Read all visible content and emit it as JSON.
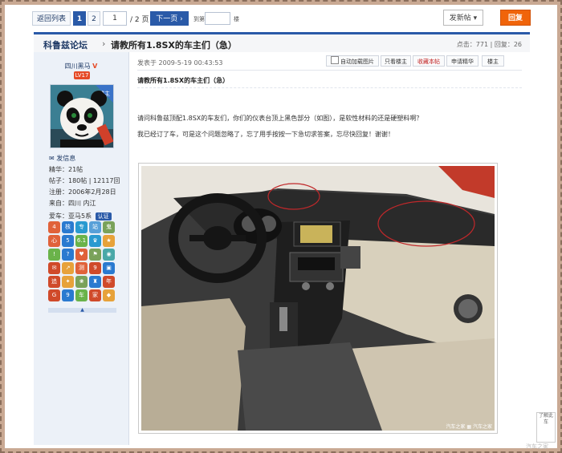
{
  "toolbar": {
    "back": "返回列表",
    "page1": "1",
    "page2": "2",
    "page_input": "1",
    "page_total": "/ 2 页",
    "next": "下一页 ›",
    "goto": "到第",
    "goto_unit": "楼",
    "new_post": "发新帖 ▾",
    "reply": "回复"
  },
  "titlebar": {
    "forum": "科鲁兹论坛",
    "separator": "›",
    "title": "请教所有1.8SX的车主们（急）",
    "stats": "点击：771 | 回复：26"
  },
  "author": {
    "name": "四川黑马",
    "v": "V",
    "level": "LV17",
    "badge": "楼主",
    "message": "发信息",
    "essence": "精华：21帖",
    "posts": "帖子：180帖 | 12117回",
    "registered": "注册：2006年2月28日",
    "from": "来自：四川 内江",
    "car": "爱车：亚马5系",
    "car_badge": "认证"
  },
  "medals": [
    {
      "t": "4",
      "c": "#e0623a"
    },
    {
      "t": "核",
      "c": "#2a7ad0"
    },
    {
      "t": "专",
      "c": "#2a9ad0"
    },
    {
      "t": "站",
      "c": "#58a0d8"
    },
    {
      "t": "鬼",
      "c": "#7aa25a"
    },
    {
      "t": "心",
      "c": "#e0623a"
    },
    {
      "t": "5",
      "c": "#2a7ad0"
    },
    {
      "t": "6.1",
      "c": "#6ab34a"
    },
    {
      "t": "♛",
      "c": "#2a9ad0"
    },
    {
      "t": "★",
      "c": "#e7a23a"
    },
    {
      "t": "!",
      "c": "#6ab34a"
    },
    {
      "t": "?",
      "c": "#2a7ad0"
    },
    {
      "t": "♥",
      "c": "#e0623a"
    },
    {
      "t": "⚑",
      "c": "#7aa25a"
    },
    {
      "t": "◉",
      "c": "#4aa8a8"
    },
    {
      "t": "✉",
      "c": "#d04a2a"
    },
    {
      "t": "↗",
      "c": "#e7a23a"
    },
    {
      "t": "测",
      "c": "#e0623a"
    },
    {
      "t": "9",
      "c": "#d04a2a"
    },
    {
      "t": "▣",
      "c": "#2a7ad0"
    },
    {
      "t": "追",
      "c": "#d04a2a"
    },
    {
      "t": "✦",
      "c": "#e7a23a"
    },
    {
      "t": "❀",
      "c": "#7aa25a"
    },
    {
      "t": "♜",
      "c": "#2a7ad0"
    },
    {
      "t": "年",
      "c": "#d04a2a"
    },
    {
      "t": "G",
      "c": "#d04a2a"
    },
    {
      "t": "9",
      "c": "#2a7ad0"
    },
    {
      "t": "车",
      "c": "#6ab34a"
    },
    {
      "t": "家",
      "c": "#d04a2a"
    },
    {
      "t": "◆",
      "c": "#e7a23a"
    }
  ],
  "post": {
    "date": "发表于 2009-5-19 00:43:53",
    "tool_pics": "自动加载图片",
    "tool_author": "只看楼主",
    "tool_collect": "收藏本帖",
    "tool_apply": "申请精华",
    "tool_floor": "楼主",
    "title": "请教所有1.8SX的车主们（急）",
    "line1": "请问科鲁兹顶配1.8SX的车友们，你们的仪表台顶上黑色部分（如图），是软性材料的还是硬塑料啊？",
    "line2": "我已经订了车，可是这个问题忽略了，忘了用手按按一下急切求答案，忘尽快回复！谢谢！",
    "photo_caption": "汽车之家 ▦ 汽车之家"
  },
  "side": {
    "info": "了解此车"
  },
  "watermark": "汽车之家"
}
